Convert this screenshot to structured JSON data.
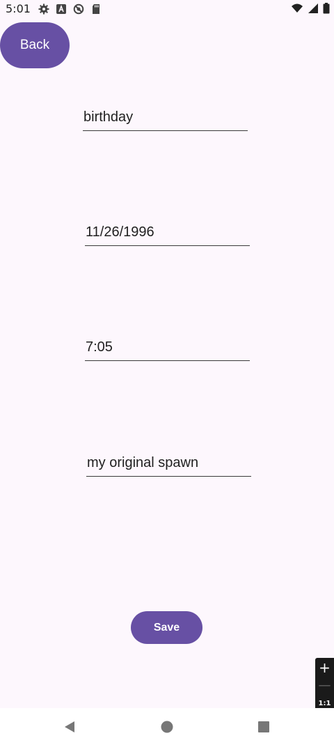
{
  "status_bar": {
    "time": "5:01",
    "icons": [
      "settings-icon",
      "a-icon",
      "blocked-icon",
      "sd-card-icon",
      "wifi-icon",
      "signal-icon",
      "battery-icon"
    ]
  },
  "back_button": {
    "label": "Back"
  },
  "form": {
    "name": {
      "value": "birthday"
    },
    "date": {
      "value": "11/26/1996"
    },
    "time": {
      "value": "7:05"
    },
    "notes": {
      "value": "my original spawn"
    }
  },
  "save_button": {
    "label": "Save"
  },
  "zoom_controls": {
    "zoom_in": "+",
    "zoom_out": "—",
    "reset": "1:1"
  },
  "colors": {
    "accent": "#6750a4",
    "background": "#fdf7fd"
  }
}
